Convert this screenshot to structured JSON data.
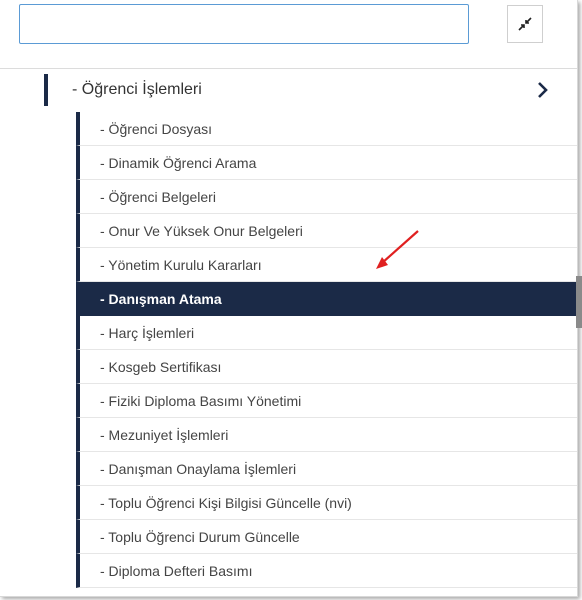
{
  "search": {
    "value": "",
    "placeholder": ""
  },
  "icons": {
    "collapse": "collapse-arrows-icon",
    "chevron": "chevron-right-icon",
    "annotation": "red-arrow-icon"
  },
  "colors": {
    "navy": "#1b2a47",
    "search_border": "#5b9bd5",
    "annotation": "#e02020"
  },
  "menu": {
    "group_label": "- Öğrenci İşlemleri",
    "items": [
      {
        "label": "- Öğrenci Dosyası"
      },
      {
        "label": "- Dinamik Öğrenci Arama"
      },
      {
        "label": "- Öğrenci Belgeleri"
      },
      {
        "label": "- Onur Ve Yüksek Onur Belgeleri"
      },
      {
        "label": "- Yönetim Kurulu Kararları"
      },
      {
        "label": "- Danışman Atama",
        "active": true
      },
      {
        "label": "- Harç İşlemleri"
      },
      {
        "label": "- Kosgeb Sertifikası"
      },
      {
        "label": "- Fiziki Diploma Basımı Yönetimi"
      },
      {
        "label": "- Mezuniyet İşlemleri"
      },
      {
        "label": "- Danışman Onaylama İşlemleri"
      },
      {
        "label": "- Toplu Öğrenci Kişi Bilgisi Güncelle (nvi)"
      },
      {
        "label": "- Toplu Öğrenci Durum Güncelle"
      },
      {
        "label": "- Diploma Defteri Basımı"
      }
    ]
  }
}
